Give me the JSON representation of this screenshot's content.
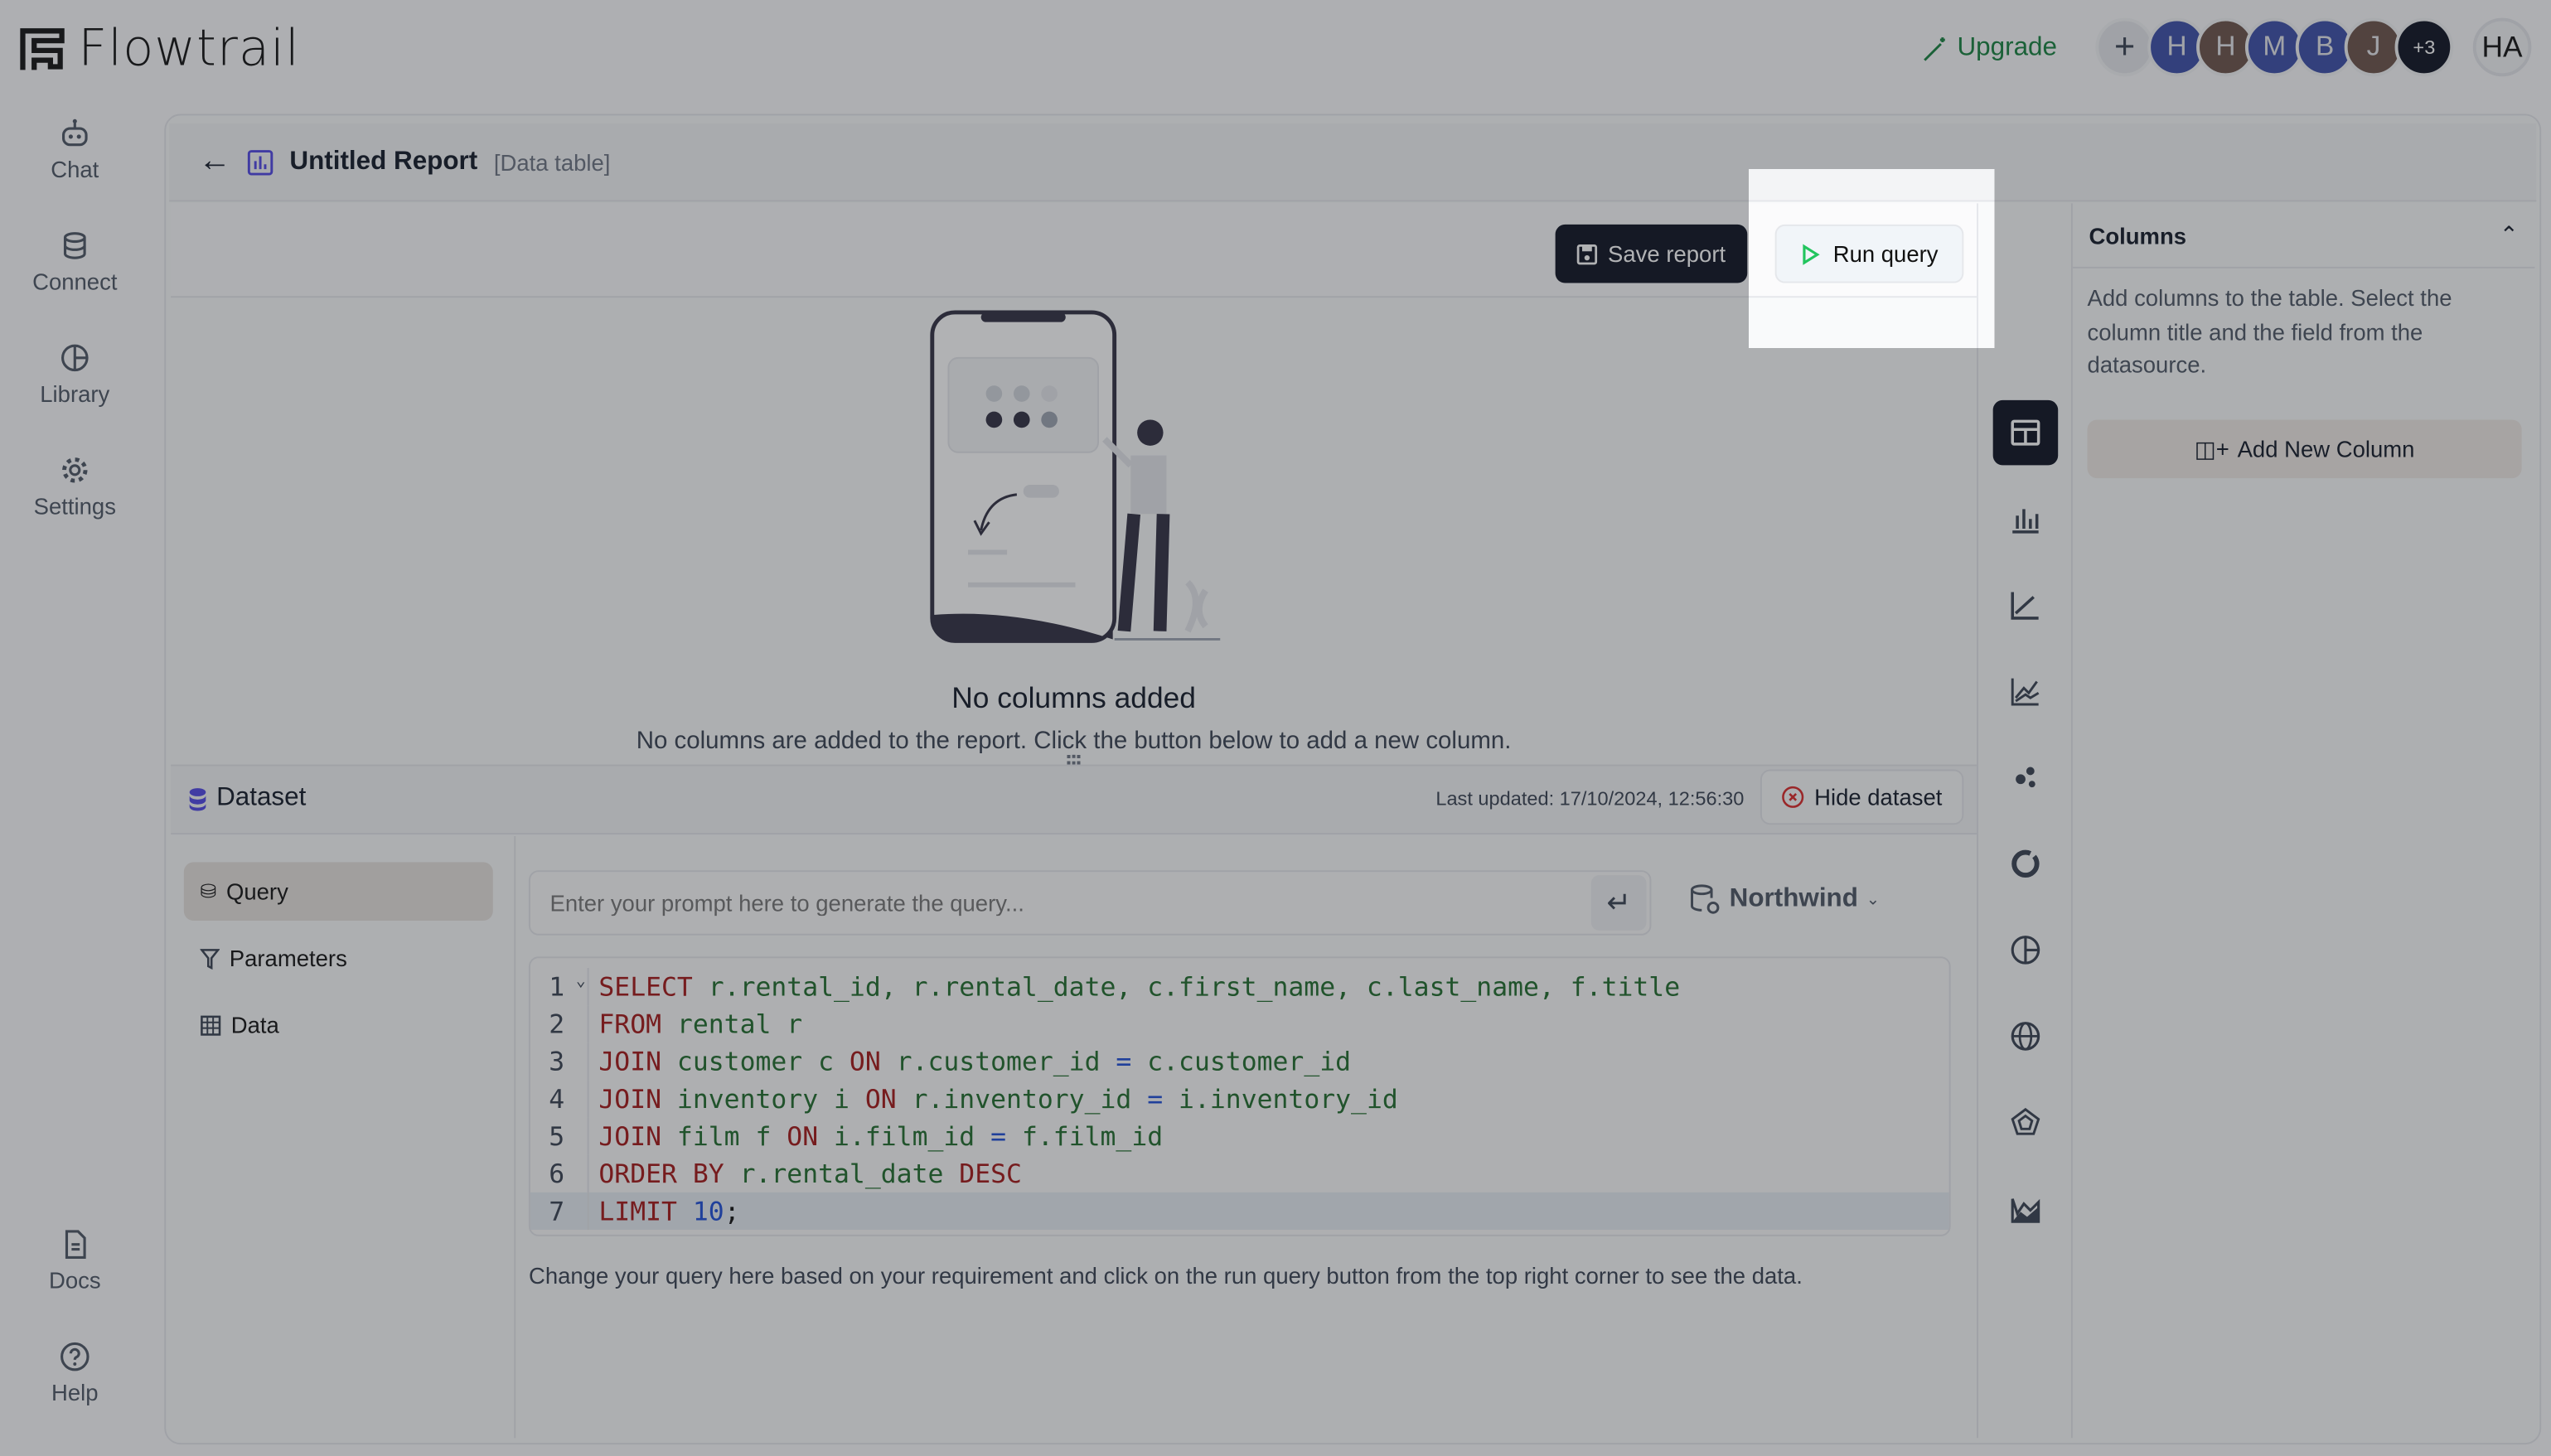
{
  "app": {
    "name": "Flowtrail"
  },
  "topbar": {
    "upgrade_label": "Upgrade",
    "add_icon": "plus-icon",
    "avatars": [
      {
        "initial": "H",
        "color": "#3b4ea8"
      },
      {
        "initial": "H",
        "color": "#6b5249"
      },
      {
        "initial": "M",
        "color": "#3b4ea8"
      },
      {
        "initial": "B",
        "color": "#3b4ea8"
      },
      {
        "initial": "J",
        "color": "#6b5249"
      }
    ],
    "more_count": "+3",
    "user_initials": "HA"
  },
  "sidebar": {
    "items": [
      {
        "label": "Chat",
        "icon": "robot-icon"
      },
      {
        "label": "Connect",
        "icon": "database-icon"
      },
      {
        "label": "Library",
        "icon": "pie-chart-icon"
      },
      {
        "label": "Settings",
        "icon": "gear-icon"
      }
    ],
    "bottom": [
      {
        "label": "Docs",
        "icon": "document-icon"
      },
      {
        "label": "Help",
        "icon": "help-icon"
      }
    ]
  },
  "report": {
    "title": "Untitled Report",
    "type": "[Data table]",
    "save_label": "Save report",
    "run_label": "Run query",
    "empty_title": "No columns added",
    "empty_text": "No columns are added to the report. Click the button below to add a new column."
  },
  "dataset": {
    "title": "Dataset",
    "last_updated": "Last updated: 17/10/2024, 12:56:30",
    "hide_label": "Hide dataset",
    "tabs": [
      {
        "label": "Query",
        "active": true
      },
      {
        "label": "Parameters"
      },
      {
        "label": "Data"
      }
    ],
    "prompt_placeholder": "Enter your prompt here to generate the query...",
    "datasource": "Northwind",
    "help_text": "Change your query here based on your requirement and click on the run query button from the top right corner to see the data.",
    "code": [
      [
        [
          "kw",
          "SELECT"
        ],
        [
          "id",
          " r.rental_id, r.rental_date, c.first_name, c.last_name, f.title"
        ]
      ],
      [
        [
          "kw",
          "FROM"
        ],
        [
          "id",
          " rental r"
        ]
      ],
      [
        [
          "kw",
          "JOIN"
        ],
        [
          "id",
          " customer c "
        ],
        [
          "kw",
          "ON"
        ],
        [
          "id",
          " r.customer_id "
        ],
        [
          "op",
          "="
        ],
        [
          "id",
          " c.customer_id"
        ]
      ],
      [
        [
          "kw",
          "JOIN"
        ],
        [
          "id",
          " inventory i "
        ],
        [
          "kw",
          "ON"
        ],
        [
          "id",
          " r.inventory_id "
        ],
        [
          "op",
          "="
        ],
        [
          "id",
          " i.inventory_id"
        ]
      ],
      [
        [
          "kw",
          "JOIN"
        ],
        [
          "id",
          " film f "
        ],
        [
          "kw",
          "ON"
        ],
        [
          "id",
          " i.film_id "
        ],
        [
          "op",
          "="
        ],
        [
          "id",
          " f.film_id"
        ]
      ],
      [
        [
          "kw",
          "ORDER BY"
        ],
        [
          "id",
          " r.rental_date "
        ],
        [
          "kw",
          "DESC"
        ]
      ],
      [
        [
          "kw",
          "LIMIT"
        ],
        [
          "pl",
          " "
        ],
        [
          "num",
          "10"
        ],
        [
          "pl",
          ";"
        ]
      ]
    ]
  },
  "chart_types": [
    "table-icon",
    "bar-chart-icon",
    "line-chart-icon",
    "multi-line-chart-icon",
    "scatter-icon",
    "donut-icon",
    "pie-icon",
    "globe-icon",
    "radar-icon",
    "area-chart-icon"
  ],
  "columns_panel": {
    "title": "Columns",
    "description": "Add columns to the table. Select the column title and the field from the datasource.",
    "add_label": "Add New Column"
  }
}
